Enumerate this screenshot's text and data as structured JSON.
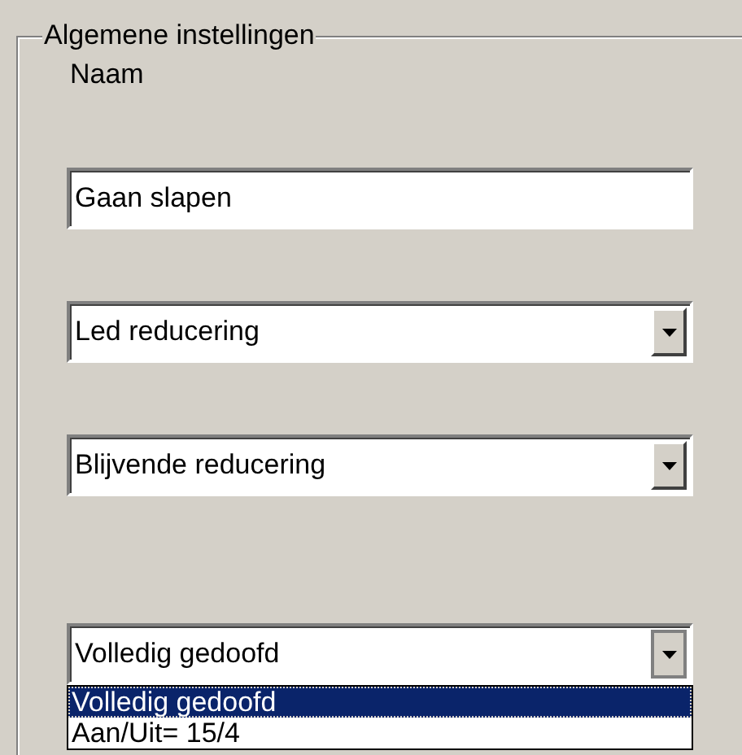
{
  "group": {
    "title": "Algemene instellingen"
  },
  "name_label": "Naam",
  "name_field": {
    "value": "Gaan slapen"
  },
  "dropdowns": [
    {
      "value": "Led reducering",
      "expanded": false
    },
    {
      "value": "Blijvende reducering",
      "expanded": false
    },
    {
      "value": "Volledig gedoofd",
      "expanded": true,
      "options": [
        {
          "label": "Volledig gedoofd",
          "selected": true
        },
        {
          "label": "Aan/Uit= 15/4",
          "selected": false
        }
      ]
    }
  ]
}
